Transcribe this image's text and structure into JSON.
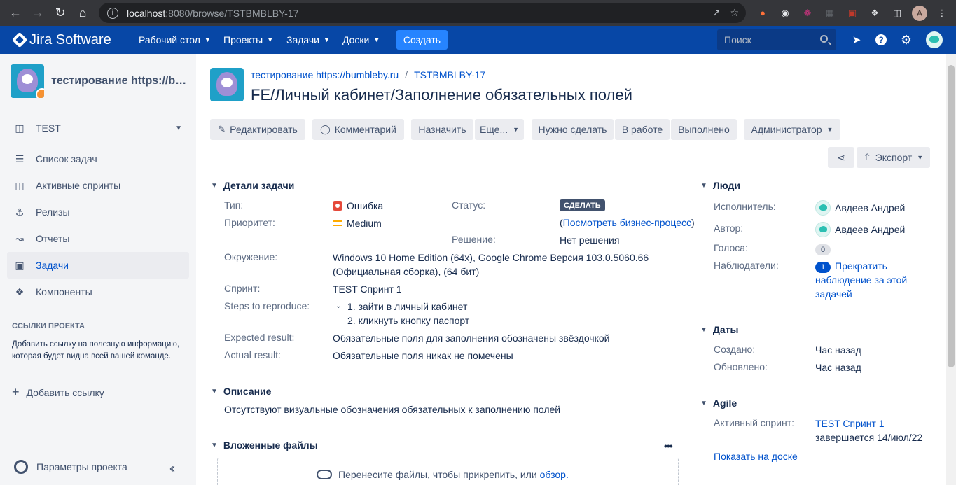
{
  "browser": {
    "url_host": "localhost",
    "url_path": ":8080/browse/TSTBMBLBY-17",
    "profile_letter": "A"
  },
  "topnav": {
    "logo_text": "Jira Software",
    "menus": [
      "Рабочий стол",
      "Проекты",
      "Задачи",
      "Доски"
    ],
    "create_label": "Создать",
    "search_placeholder": "Поиск"
  },
  "sidebar": {
    "project_name": "тестирование https://bumbleby.ru",
    "board_selector": "TEST",
    "items": [
      {
        "label": "Список задач",
        "icon": "backlog-icon"
      },
      {
        "label": "Активные спринты",
        "icon": "board-icon"
      },
      {
        "label": "Релизы",
        "icon": "ship-icon"
      },
      {
        "label": "Отчеты",
        "icon": "chart-icon"
      },
      {
        "label": "Задачи",
        "icon": "issues-icon"
      },
      {
        "label": "Компоненты",
        "icon": "puzzle-icon"
      }
    ],
    "links_heading": "ССЫЛКИ ПРОЕКТА",
    "links_note": "Добавить ссылку на полезную информацию, которая будет видна всей вашей команде.",
    "add_link_label": "Добавить ссылку",
    "settings_label": "Параметры проекта"
  },
  "issue": {
    "breadcrumb_project": "тестирование https://bumbleby.ru",
    "breadcrumb_sep": "/",
    "breadcrumb_key": "TSTBMBLBY-17",
    "title": "FE/Личный кабинет/Заполнение обязательных полей"
  },
  "toolbar": {
    "edit": "Редактировать",
    "comment": "Комментарий",
    "assign": "Назначить",
    "more": "Еще...",
    "todo": "Нужно сделать",
    "in_progress": "В работе",
    "done": "Выполнено",
    "admin": "Администратор",
    "export": "Экспорт"
  },
  "details": {
    "heading": "Детали задачи",
    "type_label": "Тип:",
    "type_value": "Ошибка",
    "priority_label": "Приоритет:",
    "priority_value": "Medium",
    "status_label": "Статус:",
    "status_value": "СДЕЛАТЬ",
    "workflow_open": "(",
    "workflow_link": "Посмотреть бизнес-процесс",
    "workflow_close": ")",
    "resolution_label": "Решение:",
    "resolution_value": "Нет решения",
    "env_label": "Окружение:",
    "env_value": "Windows 10 Home Edition (64x), Google Chrome Версия 103.0.5060.66 (Официальная сборка), (64 бит)",
    "sprint_label": "Спринт:",
    "sprint_value": "TEST Спринт 1",
    "steps_label": "Steps to reproduce:",
    "steps": [
      "1. зайти в личный кабинет",
      "2. кликнуть кнопку паспорт"
    ],
    "expected_label": "Expected result:",
    "expected_value": "Обязательные поля для заполнения обозначены звёздочкой",
    "actual_label": "Actual result:",
    "actual_value": "Обязательные поля никак не помечены"
  },
  "description": {
    "heading": "Описание",
    "text": "Отсутствуют визуальные обозначения обязательных к заполнению полей"
  },
  "attachments": {
    "heading": "Вложенные файлы",
    "more": "•••",
    "drop_text": "Перенесите файлы, чтобы прикрепить, или ",
    "browse_link": "обзор."
  },
  "people": {
    "heading": "Люди",
    "assignee_label": "Исполнитель:",
    "assignee": "Авдеев Андрей",
    "reporter_label": "Автор:",
    "reporter": "Авдеев Андрей",
    "votes_label": "Голоса:",
    "votes": "0",
    "watchers_label": "Наблюдатели:",
    "watchers": "1",
    "stop_watching": "Прекратить наблюдение за этой задачей"
  },
  "dates": {
    "heading": "Даты",
    "created_label": "Создано:",
    "created": "Час назад",
    "updated_label": "Обновлено:",
    "updated": "Час назад"
  },
  "agile": {
    "heading": "Agile",
    "sprint_label": "Активный спринт:",
    "sprint_link": "TEST Спринт 1",
    "sprint_ends": "завершается 14/июл/22",
    "board_link": "Показать на доске"
  }
}
